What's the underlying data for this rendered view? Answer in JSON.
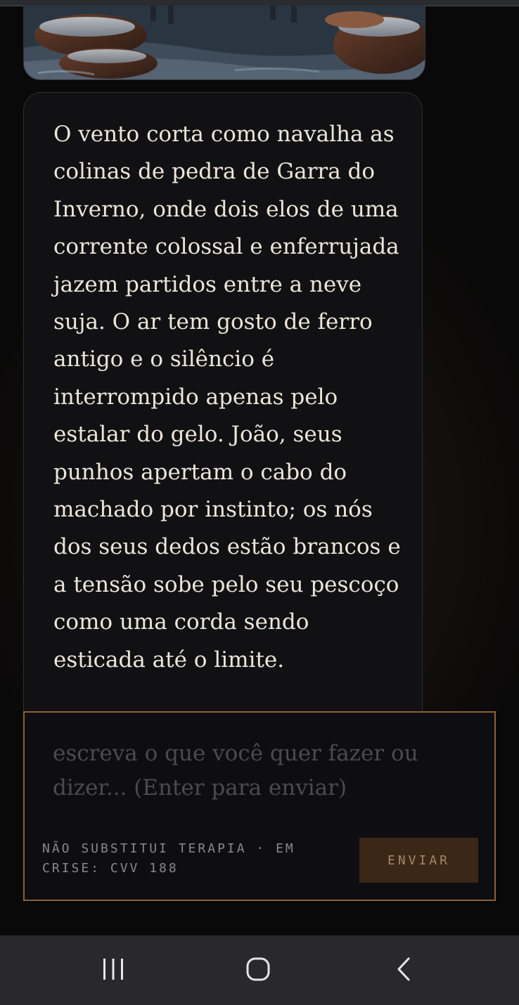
{
  "narration": {
    "text": "O vento corta como navalha as colinas de pedra de Garra do Inverno, onde dois elos de uma corrente colossal e enferrujada jazem partidos entre a neve suja. O ar tem gosto de ferro antigo e o silêncio é interrompido apenas pelo estalar do gelo. João, seus punhos apertam o cabo do machado por instinto; os nós dos seus dedos estão brancos e a tensão sobe pelo seu pescoço como uma corda sendo esticada até o limite."
  },
  "composer": {
    "value": "",
    "placeholder": "escreva o que você quer fazer ou dizer... (Enter para enviar)",
    "disclaimer": "NÃO SUBSTITUI TERAPIA · EM CRISE: CVV 188",
    "send_label": "ENVIAR"
  },
  "system_nav": {
    "icons": [
      "recent-apps-icon",
      "home-icon",
      "back-icon"
    ]
  },
  "colors": {
    "accent_border": "#8c5f38",
    "send_button_bg": "#3b2716",
    "send_button_text": "#a38768",
    "text_primary": "#ece6da",
    "placeholder": "#4c4a4c"
  }
}
